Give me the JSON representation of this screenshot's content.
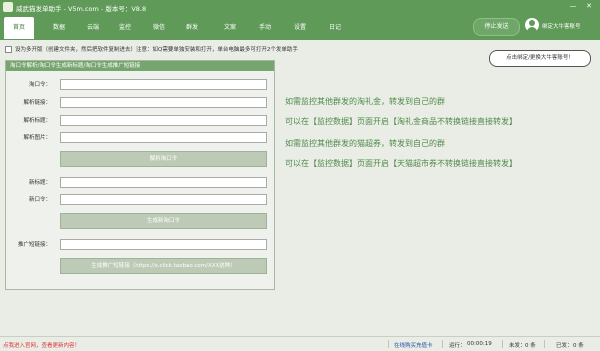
{
  "window": {
    "title": "威武猫发单助手 - V5m.com - 版本号：V8.8",
    "min": "—",
    "close": "✕"
  },
  "tabs": [
    "首页",
    "数据",
    "云端",
    "监控",
    "微信",
    "群发",
    "文案",
    "手动",
    "设置",
    "日记"
  ],
  "active_tab": 0,
  "send_button": "停止发送",
  "user_label": "绑定大牛客账号",
  "multi_open_text": "设为多开版（创建文件夹，然后把软件复制进去）注意：如Q需要单独安装和打开，单台电脑最多可打开2个发单助手",
  "bubble_text": "点击绑定/更换大牛客账号！",
  "panel": {
    "header": "淘口令解析/淘口令生成新标题/淘口令生成推广短链接",
    "fields": [
      "淘口令：",
      "解析链接：",
      "解析标题：",
      "解析图片："
    ],
    "parse_button": "解析淘口令",
    "new_fields": [
      "新标题：",
      "新口令："
    ],
    "generate_button": "生成新淘口令",
    "short_link_label": "推广短链接：",
    "short_link_button": "生成推广短链接（https://s.click.taobao.com/XXX这种）"
  },
  "info": [
    "如需监控其他群发的淘礼金，转发到自己的群",
    "可以在【监控数据】页面开启【淘礼金商品不转换链接直接转发】",
    "如需监控其他群发的猫超券，转发到自己的群",
    "可以在【监控数据】页面开启【天猫超市券不转换链接直接转发】"
  ],
  "status": {
    "left": "点我进入官网，查看更新内容！",
    "buy_card": "在线购买充值卡",
    "run_label": "运行：",
    "run_value": "00:00:19",
    "unsent_label": "未发：",
    "unsent_value": "0 条",
    "sent_label": "已发：",
    "sent_value": "0 条"
  }
}
